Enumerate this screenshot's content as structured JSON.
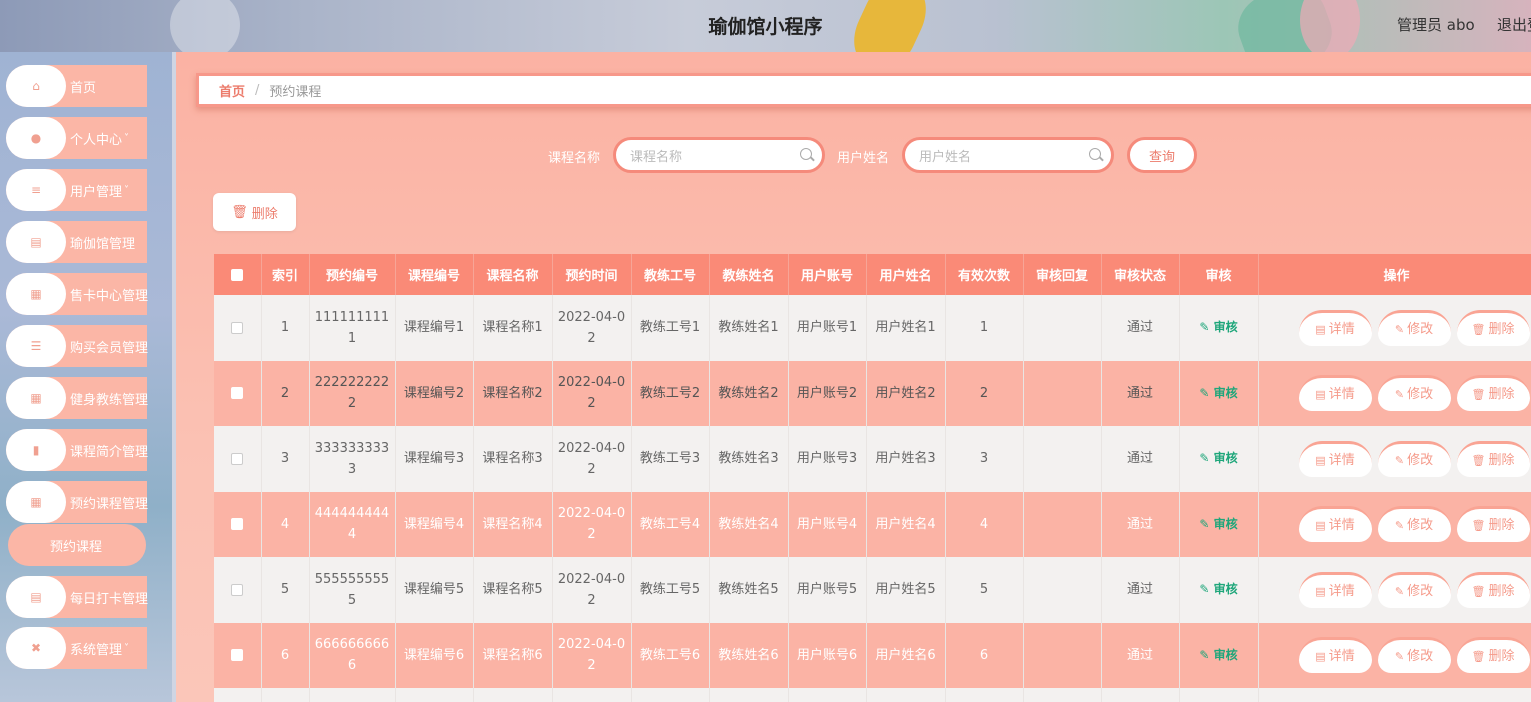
{
  "header": {
    "title": "瑜伽馆小程序",
    "admin": "管理员 abo",
    "logout": "退出登录"
  },
  "sidebar": {
    "items": [
      {
        "label": "首页",
        "icon": "home-icon"
      },
      {
        "label": "个人中心",
        "icon": "user-icon",
        "arrow": true
      },
      {
        "label": "用户管理",
        "icon": "list-icon",
        "arrow": true
      },
      {
        "label": "瑜伽馆管理",
        "icon": "clipboard-icon"
      },
      {
        "label": "售卡中心管理",
        "icon": "grid-icon"
      },
      {
        "label": "购买会员管理",
        "icon": "sliders-icon"
      },
      {
        "label": "健身教练管理",
        "icon": "grid-icon"
      },
      {
        "label": "课程简介管理",
        "icon": "bar-chart-icon"
      },
      {
        "label": "预约课程管理",
        "icon": "grid-icon"
      },
      {
        "label": "预约课程",
        "sub": true
      },
      {
        "label": "每日打卡管理",
        "icon": "clipboard-icon"
      },
      {
        "label": "系统管理",
        "icon": "gear-icon",
        "arrow": true
      }
    ]
  },
  "breadcrumb": {
    "home": "首页",
    "separator": "/",
    "current": "预约课程"
  },
  "search": {
    "course_label": "课程名称",
    "course_placeholder": "课程名称",
    "user_label": "用户姓名",
    "user_placeholder": "用户姓名",
    "query_button": "查询"
  },
  "toolbar": {
    "delete_label": "删除"
  },
  "table": {
    "headers": [
      "索引",
      "预约编号",
      "课程编号",
      "课程名称",
      "预约时间",
      "教练工号",
      "教练姓名",
      "用户账号",
      "用户姓名",
      "有效次数",
      "审核回复",
      "审核状态",
      "审核",
      "操作"
    ],
    "rows": [
      {
        "index": "1",
        "booking_no": "1111111111",
        "course_no": "课程编号1",
        "course_name": "课程名称1",
        "time": "2022-04-02",
        "coach_no": "教练工号1",
        "coach_name": "教练姓名1",
        "user_acct": "用户账号1",
        "user_name": "用户姓名1",
        "count": "1",
        "reply": "",
        "status": "通过"
      },
      {
        "index": "2",
        "booking_no": "2222222222",
        "course_no": "课程编号2",
        "course_name": "课程名称2",
        "time": "2022-04-02",
        "coach_no": "教练工号2",
        "coach_name": "教练姓名2",
        "user_acct": "用户账号2",
        "user_name": "用户姓名2",
        "count": "2",
        "reply": "",
        "status": "通过"
      },
      {
        "index": "3",
        "booking_no": "3333333333",
        "course_no": "课程编号3",
        "course_name": "课程名称3",
        "time": "2022-04-02",
        "coach_no": "教练工号3",
        "coach_name": "教练姓名3",
        "user_acct": "用户账号3",
        "user_name": "用户姓名3",
        "count": "3",
        "reply": "",
        "status": "通过"
      },
      {
        "index": "4",
        "booking_no": "4444444444",
        "course_no": "课程编号4",
        "course_name": "课程名称4",
        "time": "2022-04-02",
        "coach_no": "教练工号4",
        "coach_name": "教练姓名4",
        "user_acct": "用户账号4",
        "user_name": "用户姓名4",
        "count": "4",
        "reply": "",
        "status": "通过"
      },
      {
        "index": "5",
        "booking_no": "5555555555",
        "course_no": "课程编号5",
        "course_name": "课程名称5",
        "time": "2022-04-02",
        "coach_no": "教练工号5",
        "coach_name": "教练姓名5",
        "user_acct": "用户账号5",
        "user_name": "用户姓名5",
        "count": "5",
        "reply": "",
        "status": "通过"
      },
      {
        "index": "6",
        "booking_no": "6666666666",
        "course_no": "课程编号6",
        "course_name": "课程名称6",
        "time": "2022-04-02",
        "coach_no": "教练工号6",
        "coach_name": "教练姓名6",
        "user_acct": "用户账号6",
        "user_name": "用户姓名6",
        "count": "6",
        "reply": "",
        "status": "通过"
      }
    ],
    "audit_label": "审核",
    "actions": {
      "detail": "详情",
      "edit": "修改",
      "delete": "删除"
    }
  },
  "colors": {
    "accent": "#fa8a77",
    "row_highlight": "#fbb3a5",
    "audit_green": "#1ea67a"
  }
}
